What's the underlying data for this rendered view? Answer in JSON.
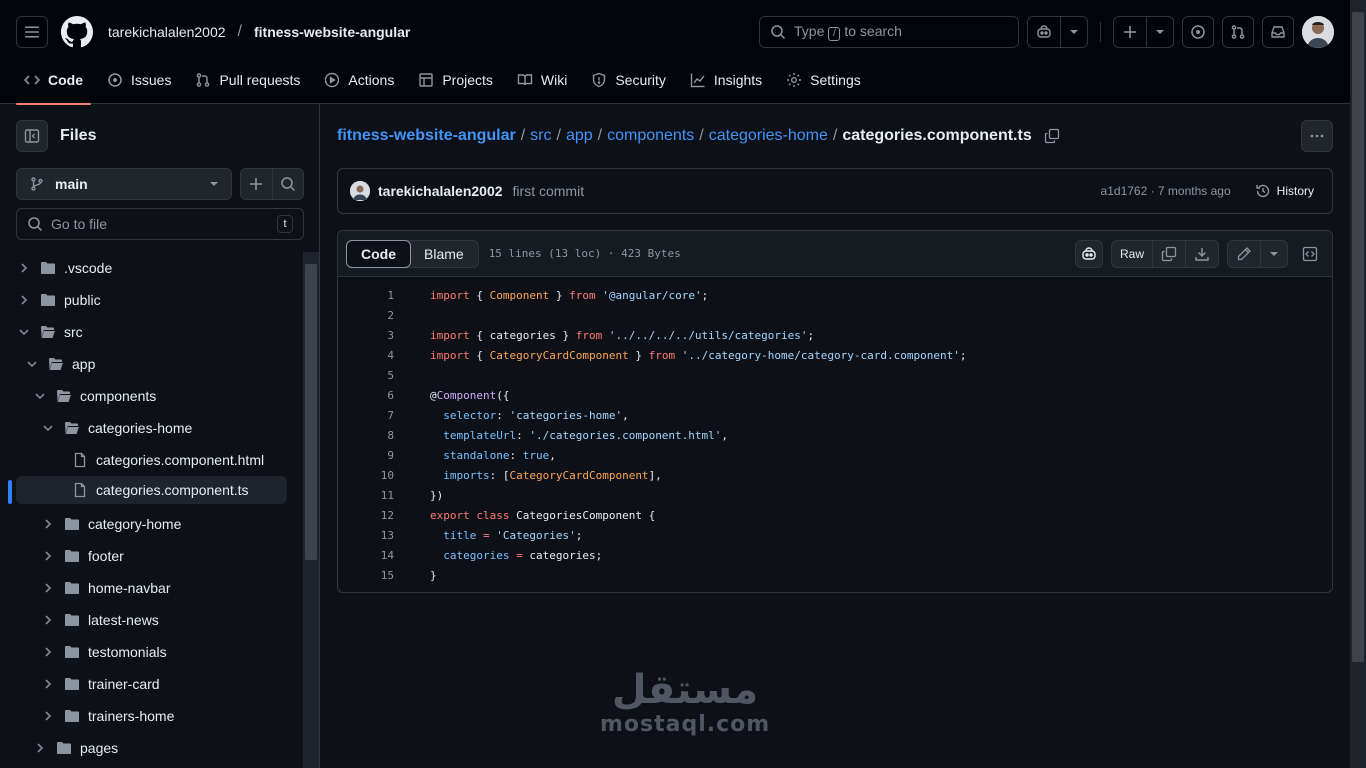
{
  "header": {
    "owner": "tarekichalalen2002",
    "separator": "/",
    "repo": "fitness-website-angular",
    "search": {
      "prefix": "Type",
      "key": "/",
      "suffix": "to search"
    }
  },
  "tabs": [
    {
      "label": "Code",
      "icon": "code-icon",
      "active": true
    },
    {
      "label": "Issues",
      "icon": "issue-icon"
    },
    {
      "label": "Pull requests",
      "icon": "pull-request-icon"
    },
    {
      "label": "Actions",
      "icon": "play-icon"
    },
    {
      "label": "Projects",
      "icon": "table-icon"
    },
    {
      "label": "Wiki",
      "icon": "book-icon"
    },
    {
      "label": "Security",
      "icon": "shield-icon"
    },
    {
      "label": "Insights",
      "icon": "graph-icon"
    },
    {
      "label": "Settings",
      "icon": "gear-icon"
    }
  ],
  "sidebar": {
    "title": "Files",
    "branch": "main",
    "goto_placeholder": "Go to file",
    "goto_key": "t",
    "tree": [
      {
        "label": ".vscode",
        "type": "folder",
        "expanded": false
      },
      {
        "label": "public",
        "type": "folder",
        "expanded": false
      },
      {
        "label": "src",
        "type": "folder",
        "expanded": true
      },
      {
        "label": "app",
        "type": "folder",
        "expanded": true
      },
      {
        "label": "components",
        "type": "folder",
        "expanded": true
      },
      {
        "label": "categories-home",
        "type": "folder",
        "expanded": true
      },
      {
        "label": "categories.component.html",
        "type": "file"
      },
      {
        "label": "categories.component.ts",
        "type": "file",
        "selected": true
      },
      {
        "label": "category-home",
        "type": "folder",
        "expanded": false
      },
      {
        "label": "footer",
        "type": "folder",
        "expanded": false
      },
      {
        "label": "home-navbar",
        "type": "folder",
        "expanded": false
      },
      {
        "label": "latest-news",
        "type": "folder",
        "expanded": false
      },
      {
        "label": "testomonials",
        "type": "folder",
        "expanded": false
      },
      {
        "label": "trainer-card",
        "type": "folder",
        "expanded": false
      },
      {
        "label": "trainers-home",
        "type": "folder",
        "expanded": false
      },
      {
        "label": "pages",
        "type": "folder",
        "expanded": false
      }
    ]
  },
  "breadcrumb": {
    "links": [
      "fitness-website-angular",
      "src",
      "app",
      "components",
      "categories-home"
    ],
    "sep": "/",
    "current": "categories.component.ts"
  },
  "commit": {
    "author": "tarekichalalen2002",
    "message": "first commit",
    "meta": "a1d1762 · 7 months ago",
    "history_label": "History"
  },
  "file": {
    "view_code": "Code",
    "view_blame": "Blame",
    "info": "15 lines (13 loc) · 423 Bytes",
    "raw_label": "Raw"
  },
  "code_lines": [
    "1",
    "2",
    "3",
    "4",
    "5",
    "6",
    "7",
    "8",
    "9",
    "10",
    "11",
    "12",
    "13",
    "14",
    "15"
  ],
  "code_tokens": {
    "l1": [
      "import",
      " { ",
      "Component",
      " } ",
      "from",
      " ",
      "'@angular/core'",
      ";"
    ],
    "l3": [
      "import",
      " { categories } ",
      "from",
      " ",
      "'../../../../utils/categories'",
      ";"
    ],
    "l4": [
      "import",
      " { ",
      "CategoryCardComponent",
      " } ",
      "from",
      " ",
      "'../category-home/category-card.component'",
      ";"
    ],
    "l6": [
      "@",
      "Component",
      "({"
    ],
    "l7": [
      "  ",
      "selector",
      ": ",
      "'categories-home'",
      ","
    ],
    "l8": [
      "  ",
      "templateUrl",
      ": ",
      "'./categories.component.html'",
      ","
    ],
    "l9": [
      "  ",
      "standalone",
      ": ",
      "true",
      ","
    ],
    "l10": [
      "  ",
      "imports",
      ": [",
      "CategoryCardComponent",
      "],"
    ],
    "l11": [
      "})"
    ],
    "l12": [
      "export",
      " ",
      "class",
      " ",
      "CategoriesComponent",
      " {"
    ],
    "l13": [
      "  ",
      "title",
      " ",
      "=",
      " ",
      "'Categories'",
      ";"
    ],
    "l14": [
      "  ",
      "categories",
      " ",
      "=",
      " categories;"
    ],
    "l15": [
      "}"
    ]
  },
  "watermark": {
    "arabic": "مستقل",
    "latin": "mostaql.com"
  },
  "colors": {
    "accent": "#f78166",
    "link": "#4493f8",
    "keyword": "#ff7b72",
    "string": "#a5d6ff",
    "function": "#d2a8ff",
    "constant": "#79c0ff"
  }
}
